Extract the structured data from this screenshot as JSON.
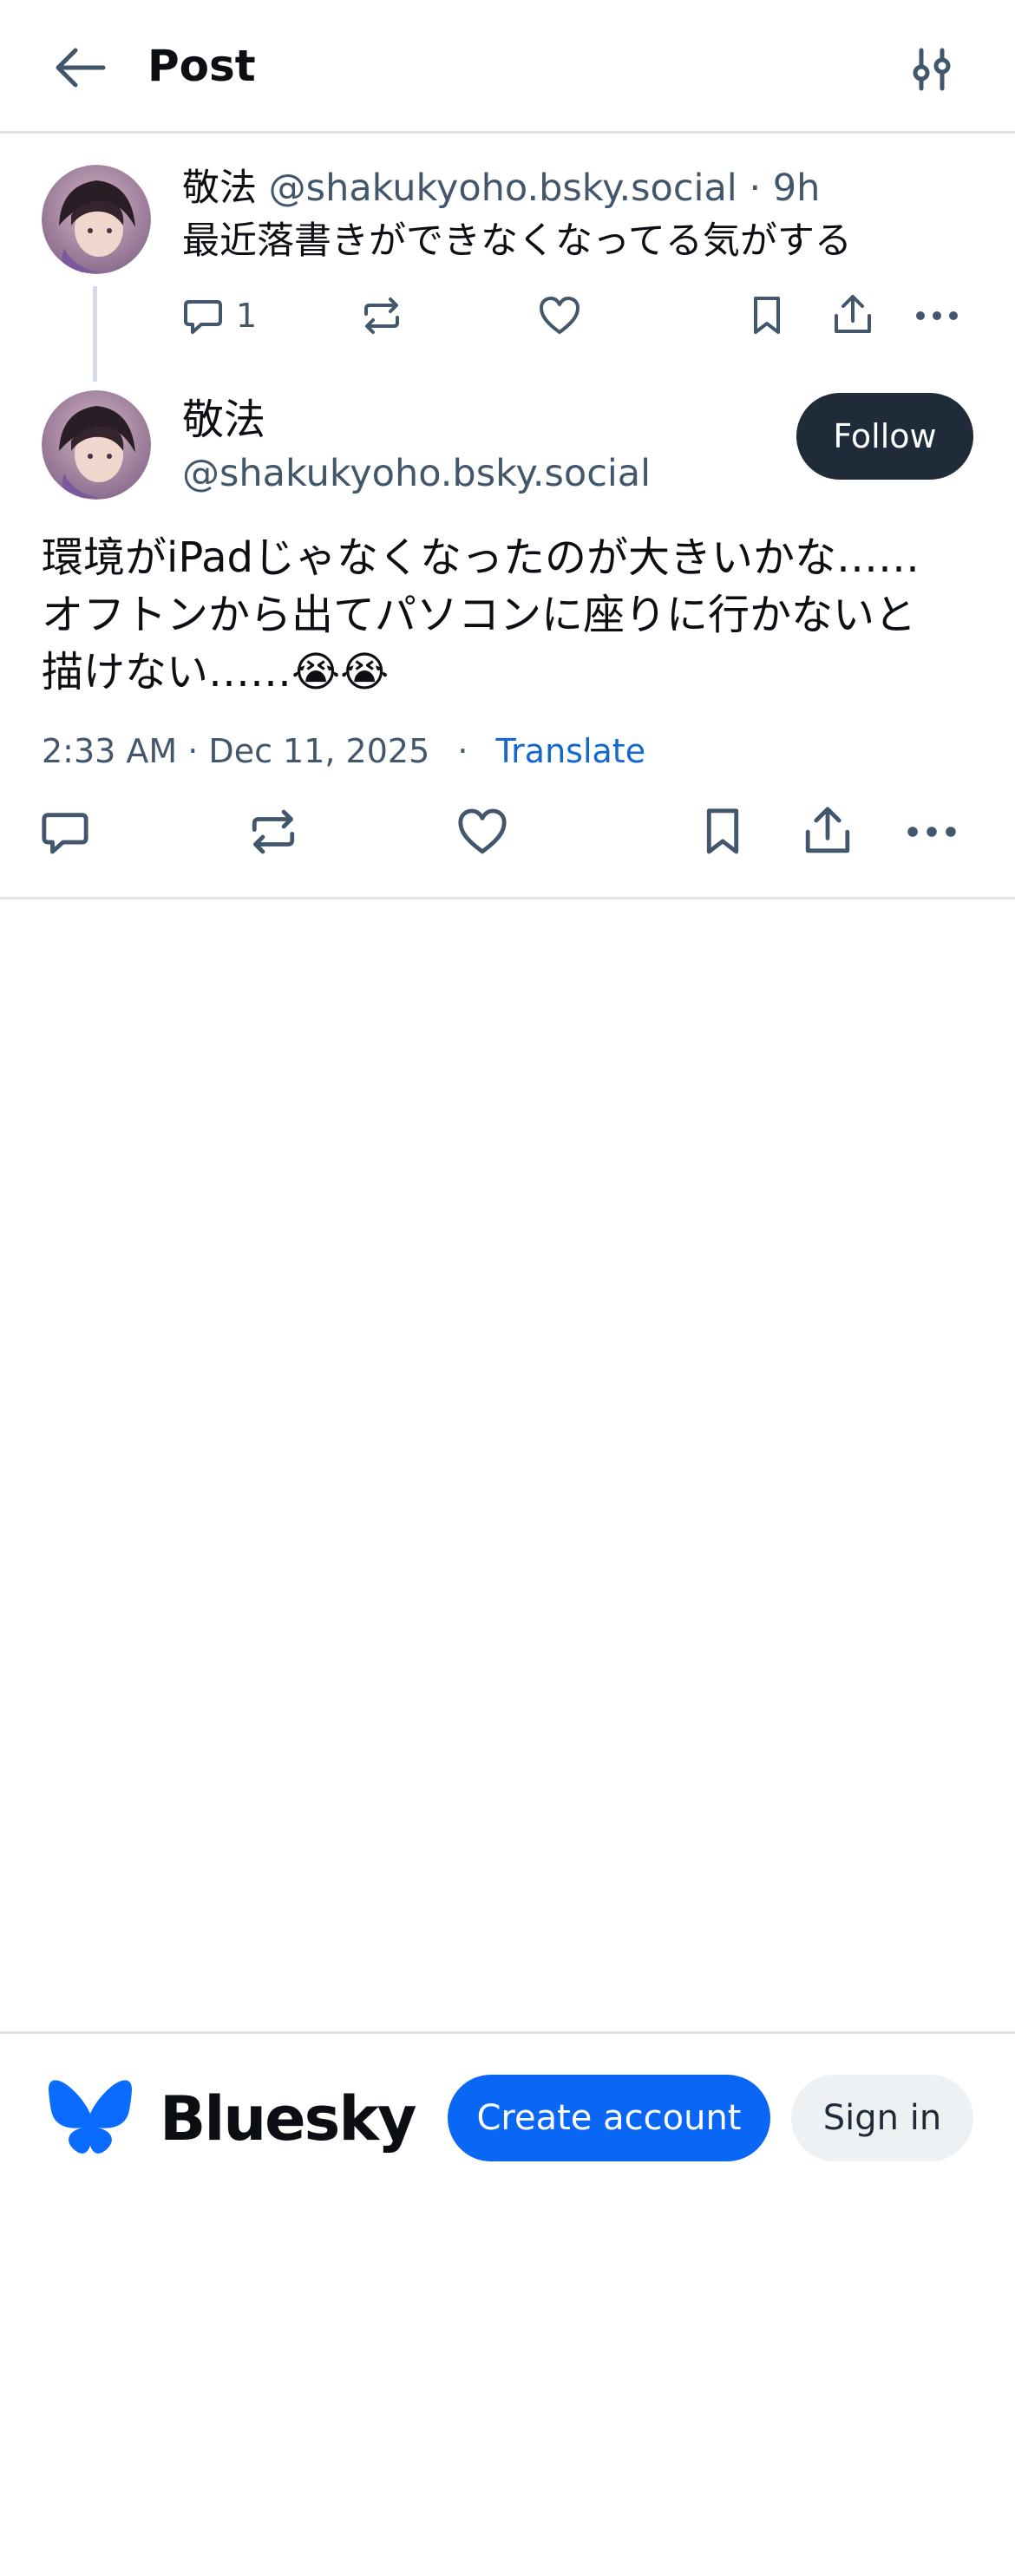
{
  "header": {
    "title": "Post",
    "back_icon": "arrow-left-icon",
    "settings_icon": "sliders-icon"
  },
  "parent_post": {
    "author_name": "敬法",
    "author_handle": "@shakukyoho.bsky.social",
    "age": "· 9h",
    "text": "最近落書きができなくなってる気がする",
    "reply_count": "1"
  },
  "main_post": {
    "author_name": "敬法",
    "author_handle": "@shakukyoho.bsky.social",
    "follow_label": "Follow",
    "text_lines": [
      "環境がiPadじゃなくなったのが大きいかな……",
      "オフトンから出てパソコンに座りに行かないと",
      "描けない……😭😭"
    ],
    "timestamp": "2:33 AM · Dec 11, 2025",
    "separator": "·",
    "translate_label": "Translate"
  },
  "bottom_bar": {
    "brand": "Bluesky",
    "create_account_label": "Create account",
    "sign_in_label": "Sign in"
  },
  "colors": {
    "accent": "#0a66f5",
    "link": "#1467d1",
    "follow_bg": "#1f2b38",
    "muted_text": "#42576c"
  }
}
